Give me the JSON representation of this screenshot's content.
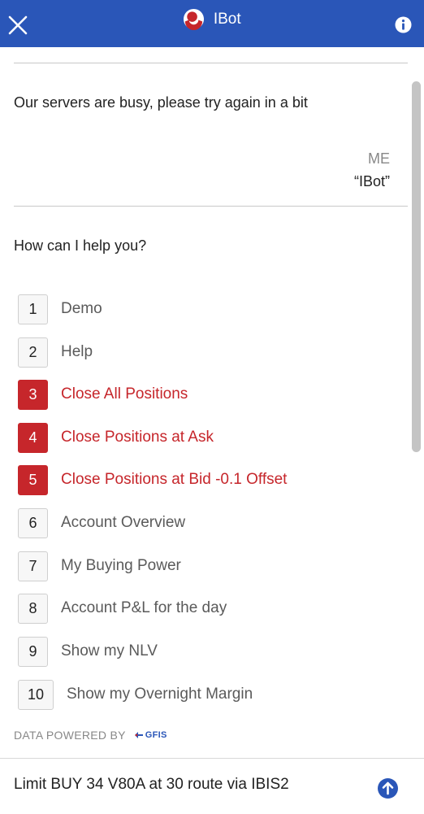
{
  "header": {
    "title": "IBot",
    "close_icon": "close-icon",
    "info_icon": "info-icon",
    "background": "#2a56b8"
  },
  "chat": {
    "bot_message_1": "Our servers are busy, please try again in a bit",
    "user_sender": "ME",
    "user_message": "“IBot”",
    "bot_message_2": "How can I help you?"
  },
  "options": [
    {
      "num": "1",
      "label": "Demo"
    },
    {
      "num": "2",
      "label": "Help"
    },
    {
      "num": "3",
      "label": "Close All Positions"
    },
    {
      "num": "4",
      "label": "Close Positions at Ask"
    },
    {
      "num": "5",
      "label": "Close Positions at Bid -0.1 Offset"
    },
    {
      "num": "6",
      "label": "Account Overview"
    },
    {
      "num": "7",
      "label": "My Buying Power"
    },
    {
      "num": "8",
      "label": "Account P&L for the day"
    },
    {
      "num": "9",
      "label": "Show my NLV"
    },
    {
      "num": "10",
      "label": "Show my Overnight Margin"
    }
  ],
  "footer": {
    "powered_by": "DATA POWERED BY",
    "provider": "GFIS"
  },
  "composer": {
    "value": "Limit BUY 34 V80A at 30 route via IBIS2",
    "send_icon": "send-icon"
  },
  "colors": {
    "accent": "#2a56b8",
    "danger": "#c6262b"
  }
}
